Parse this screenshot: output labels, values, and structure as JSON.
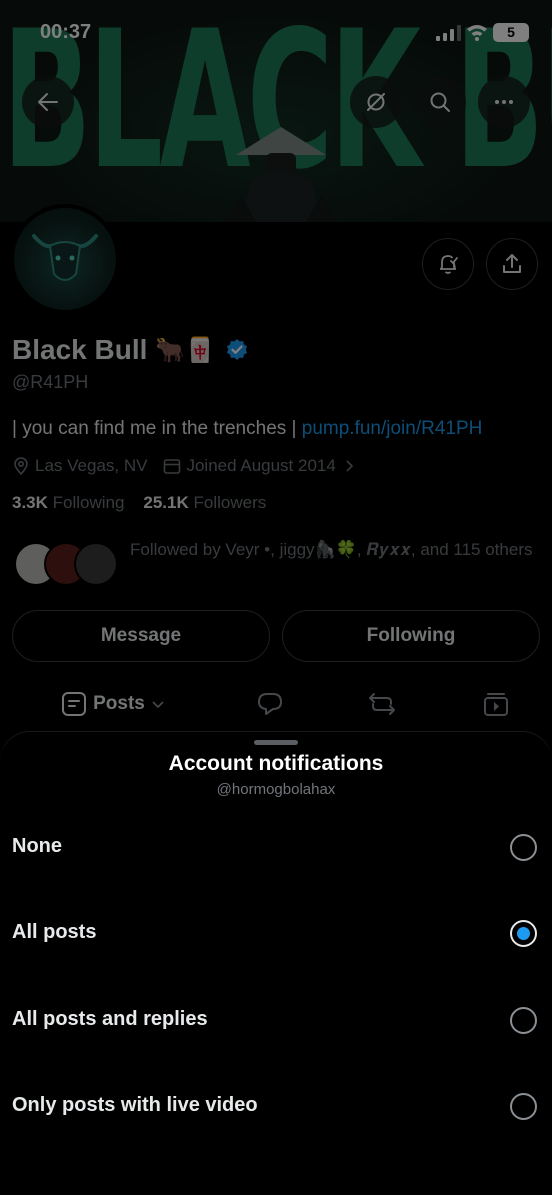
{
  "status_bar": {
    "time": "00:37",
    "battery": "5"
  },
  "banner": {
    "text": "BLACK BULL"
  },
  "profile": {
    "name": "Black Bull",
    "emoji": "🐂🀄",
    "handle": "@R41PH",
    "bio_text": "| you can find me in the trenches | ",
    "bio_link": "pump.fun/join/R41PH",
    "location": "Las Vegas, NV",
    "joined": "Joined August 2014",
    "following_count": "3.3K",
    "following_label": "Following",
    "followers_count": "25.1K",
    "followers_label": "Followers",
    "followed_by_text": "Followed by Veyr •, jiggy🦍🍀, 𝑹𝒚𝒙𝒙, and 115 others",
    "message_label": "Message",
    "following_button_label": "Following"
  },
  "tabs": {
    "posts_label": "Posts"
  },
  "sheet": {
    "title": "Account notifications",
    "subtitle": "@hormogbolahax",
    "options": [
      {
        "label": "None",
        "selected": false
      },
      {
        "label": "All posts",
        "selected": true
      },
      {
        "label": "All posts and replies",
        "selected": false
      },
      {
        "label": "Only posts with live video",
        "selected": false
      }
    ]
  },
  "colors": {
    "accent": "#1d9bf0",
    "banner_green": "#1f7a57",
    "muted": "#71767b"
  }
}
